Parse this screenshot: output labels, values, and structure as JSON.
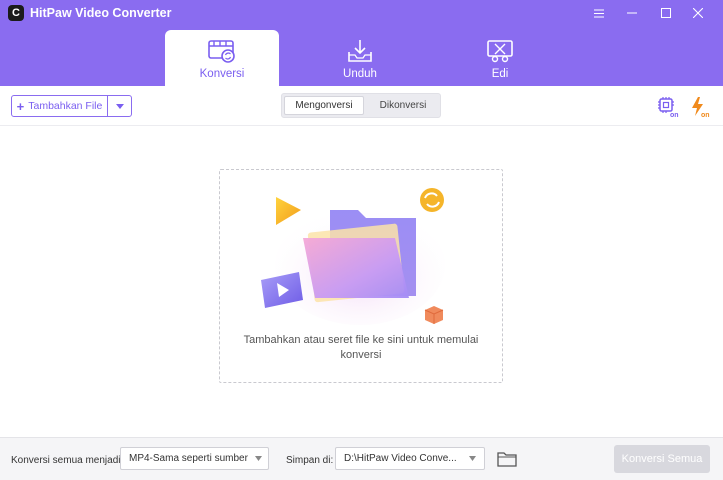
{
  "window": {
    "title": "HitPaw Video Converter",
    "logo_letter": "C"
  },
  "tabs": [
    {
      "label": "Konversi",
      "icon": "film-convert-icon",
      "active": true
    },
    {
      "label": "Unduh",
      "icon": "download-tray-icon",
      "active": false
    },
    {
      "label": "Edi",
      "icon": "edit-scissors-icon",
      "active": false
    }
  ],
  "toolbar": {
    "add_file_label": "Tambahkan File",
    "segment": {
      "converting": "Mengonversi",
      "converted": "Dikonversi"
    },
    "hw_accel_icon": "chip-on-icon",
    "turbo_icon": "lightning-on-icon",
    "badge_text": "on"
  },
  "dropzone": {
    "text": "Tambahkan atau seret file ke sini untuk memulai konversi"
  },
  "footer": {
    "convert_all_to_label": "Konversi semua menjadi:",
    "format_value": "MP4-Sama seperti sumber",
    "save_to_label": "Simpan di:",
    "path_value": "D:\\HitPaw Video Conve...",
    "convert_all_button": "Konversi Semua"
  },
  "colors": {
    "header": "#8a6cf0",
    "accent": "#7a5ef0",
    "turbo": "#f08a1c",
    "disabled_button": "#d8d8de"
  }
}
